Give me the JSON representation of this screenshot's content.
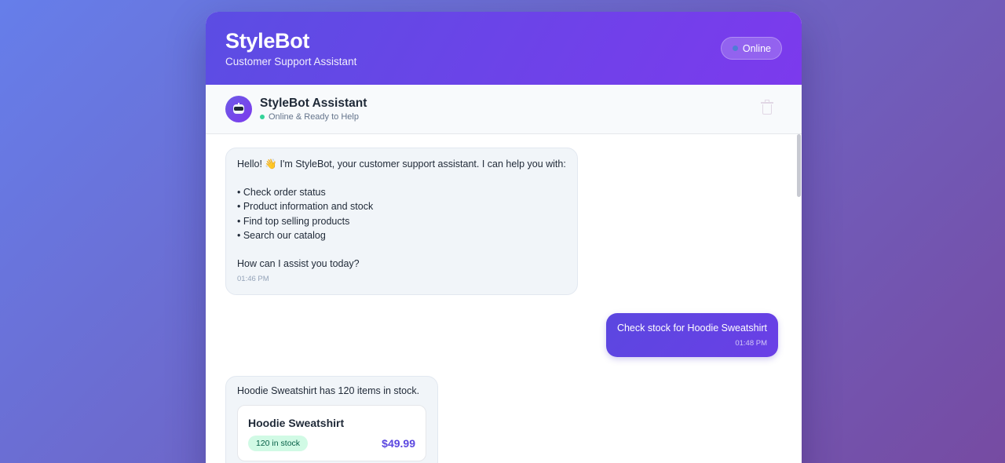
{
  "header": {
    "title": "StyleBot",
    "subtitle": "Customer Support Assistant",
    "status": "Online"
  },
  "bot_bar": {
    "name": "StyleBot Assistant",
    "status": "Online & Ready to Help",
    "avatar_icon": "robot-icon",
    "clear_icon": "trash-icon"
  },
  "messages": {
    "welcome": {
      "lines": [
        "Hello! 👋 I'm StyleBot, your customer support assistant. I can help you with:",
        "",
        "• Check order status",
        "• Product information and stock",
        "• Find top selling products",
        "• Search our catalog",
        "",
        "How can I assist you today?"
      ],
      "time": "01:46 PM"
    },
    "user_query": {
      "text": "Check stock for Hoodie Sweatshirt",
      "time": "01:48 PM"
    },
    "stock_reply": {
      "text": "Hoodie Sweatshirt has 120 items in stock.",
      "product": {
        "name": "Hoodie Sweatshirt",
        "stock": "120 in stock",
        "price": "$49.99"
      }
    }
  },
  "colors": {
    "accent": "#5b47e0",
    "header_gradient_start": "#5b4de3",
    "header_gradient_end": "#7c3aed",
    "online_dot": "#34d399",
    "stock_badge_bg": "#d1fae5"
  }
}
